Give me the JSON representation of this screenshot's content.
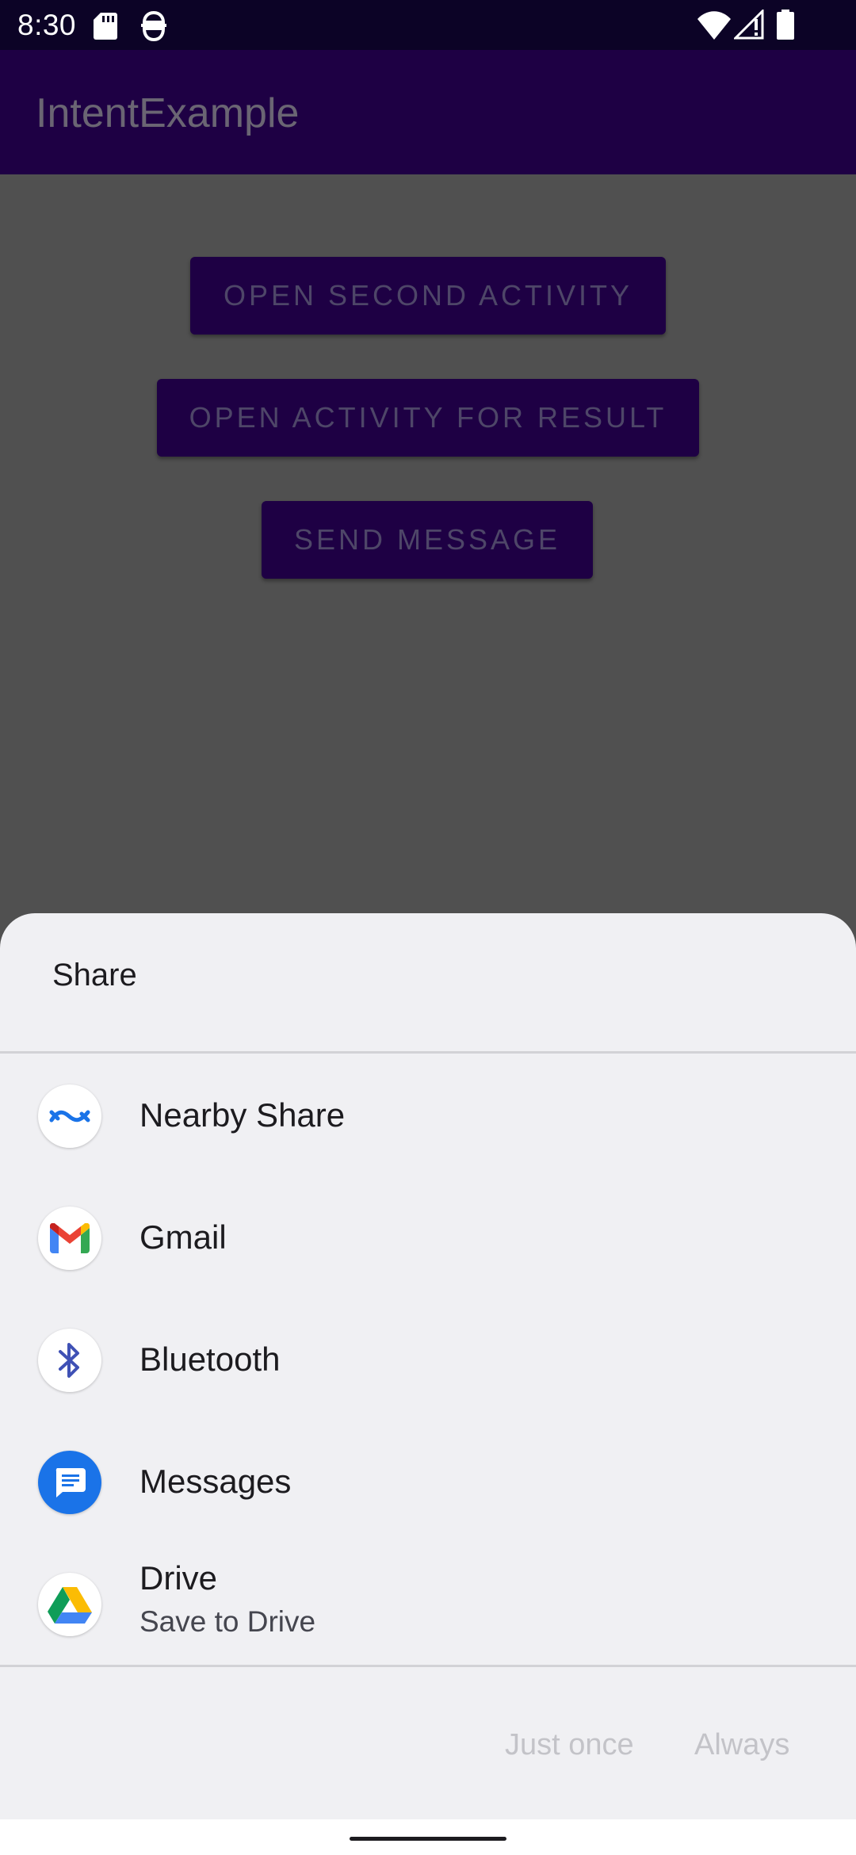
{
  "status_bar": {
    "time": "8:30",
    "icons": [
      "sd-card-icon",
      "developer-icon",
      "wifi-icon",
      "signal-icon",
      "battery-icon"
    ]
  },
  "app_bar": {
    "title": "IntentExample"
  },
  "main": {
    "buttons": [
      {
        "label": "OPEN SECOND ACTIVITY"
      },
      {
        "label": "OPEN ACTIVITY FOR RESULT"
      },
      {
        "label": "SEND MESSAGE"
      }
    ]
  },
  "share_sheet": {
    "title": "Share",
    "items": [
      {
        "label": "Nearby Share",
        "icon": "nearby-share-icon"
      },
      {
        "label": "Gmail",
        "icon": "gmail-icon"
      },
      {
        "label": "Bluetooth",
        "icon": "bluetooth-icon"
      },
      {
        "label": "Messages",
        "icon": "messages-icon"
      },
      {
        "label": "Drive",
        "sublabel": "Save to Drive",
        "icon": "drive-icon"
      }
    ],
    "actions": {
      "just_once": "Just once",
      "always": "Always"
    }
  },
  "colors": {
    "app_bar": "#1e0044",
    "status_bar": "#0c0326",
    "scrim": "#505050",
    "sheet_bg": "#f0f0f3",
    "disabled_action": "#c3c3c8"
  }
}
